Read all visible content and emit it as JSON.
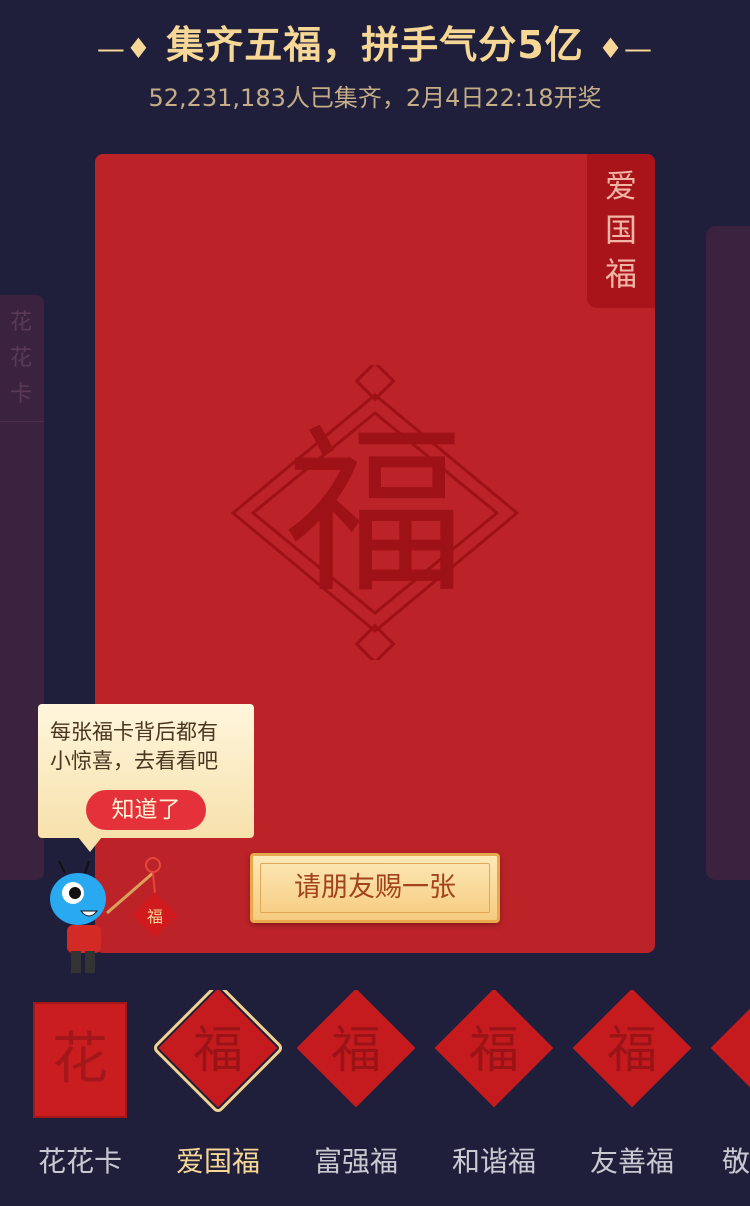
{
  "header": {
    "title": "集齐五福，拼手气分5亿",
    "deco_left": "—♦",
    "deco_right": "♦—",
    "subtitle": "52,231,183人已集齐，2月4日22:18开奖"
  },
  "side_card_left": {
    "label": "花花卡"
  },
  "main_card": {
    "tag": [
      "爱",
      "国",
      "福"
    ],
    "emblem_char": "福",
    "emblem_icon": "fu-diamond-icon"
  },
  "tooltip": {
    "line1": "每张福卡背后都有",
    "line2": "小惊喜，去看看吧",
    "button": "知道了"
  },
  "mascot": {
    "icon": "mascot-icon",
    "charm_char": "福"
  },
  "ask_friend_button": "请朋友赐一张",
  "tabs": [
    {
      "label": "花花卡",
      "glyph": "花",
      "shape": "rect"
    },
    {
      "label": "爱国福",
      "glyph": "福",
      "shape": "diamond",
      "active": true
    },
    {
      "label": "富强福",
      "glyph": "福",
      "shape": "diamond"
    },
    {
      "label": "和谐福",
      "glyph": "福",
      "shape": "diamond"
    },
    {
      "label": "友善福",
      "glyph": "福",
      "shape": "diamond"
    },
    {
      "label": "敬",
      "glyph": "",
      "shape": "diamond"
    }
  ],
  "colors": {
    "background": "#1f1f3b",
    "gold": "#f7d795",
    "card_red": "#bb2328",
    "button_red": "#e4313a"
  }
}
